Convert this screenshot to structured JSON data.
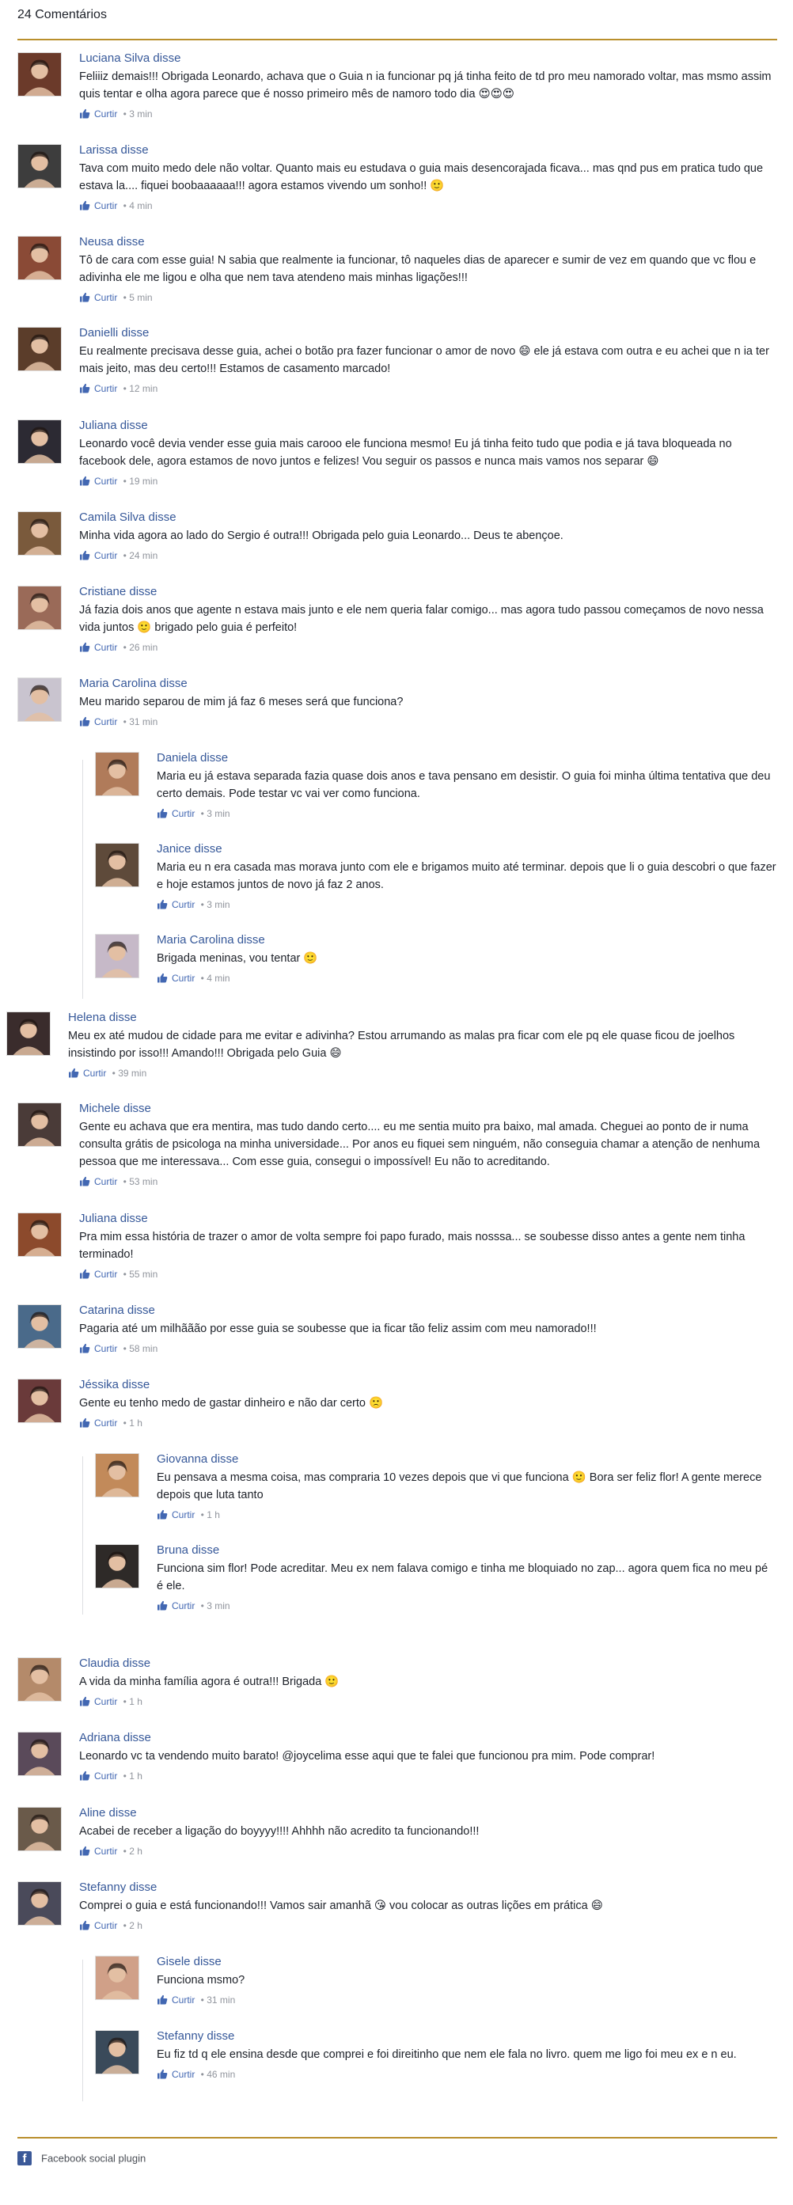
{
  "header": {
    "count_label": "24 Comentários"
  },
  "like_label": "Curtir",
  "comments": [
    {
      "name": "Luciana Silva disse",
      "text": "Feliiiz demais!!! Obrigada Leonardo, achava que o Guia n ia funcionar pq já tinha feito de td pro meu namorado voltar, mas msmo assim quis tentar e olha agora parece que é nosso primeiro mês de namoro todo dia 😍😍😍",
      "time": "3 min"
    },
    {
      "name": "Larissa disse",
      "text": "Tava com muito medo dele não voltar. Quanto mais eu estudava o guia mais desencorajada ficava... mas qnd pus em pratica tudo que estava la.... fiquei boobaaaaaa!!! agora estamos vivendo um sonho!! 🙂",
      "time": "4 min"
    },
    {
      "name": "Neusa disse",
      "text": "Tô de cara com esse guia! N sabia que realmente ia funcionar, tô naqueles dias de aparecer e sumir de vez em quando que vc flou e adivinha ele me ligou e olha que nem tava atendeno mais minhas ligações!!!",
      "time": "5 min"
    },
    {
      "name": "Danielli disse",
      "text": "Eu realmente precisava desse guia, achei o botão pra fazer funcionar o amor de novo 😄 ele já estava com outra e eu achei que n ia ter mais jeito, mas deu certo!!! Estamos de casamento marcado!",
      "time": "12 min"
    },
    {
      "name": "Juliana disse",
      "text": "Leonardo você devia vender esse guia mais carooo ele funciona mesmo! Eu já tinha feito tudo que podia e já tava bloqueada no facebook dele, agora estamos de novo juntos e felizes! Vou seguir os passos e nunca mais vamos nos separar 😄",
      "time": "19 min"
    },
    {
      "name": "Camila Silva disse",
      "text": "Minha vida agora ao lado do Sergio é outra!!! Obrigada pelo guia Leonardo... Deus te abençoe.",
      "time": "24 min"
    },
    {
      "name": "Cristiane disse",
      "text": "Já fazia dois anos que agente n estava mais junto e ele nem queria falar comigo... mas agora tudo passou começamos de novo nessa vida juntos 🙂 brigado pelo guia é perfeito!",
      "time": "26 min"
    },
    {
      "name": "Maria Carolina disse",
      "text": "Meu marido separou de mim já faz 6 meses será que funciona?",
      "time": "31 min"
    },
    {
      "name": "Daniela disse",
      "text": "Maria eu já estava separada fazia quase dois anos e tava pensano em desistir. O guia foi minha última tentativa que deu certo demais. Pode testar vc vai ver como funciona.",
      "time": "3 min"
    },
    {
      "name": "Janice disse",
      "text": "Maria eu n era casada mas morava junto com ele e brigamos muito até terminar. depois que li o guia descobri o que fazer e hoje estamos juntos de novo já faz 2 anos.",
      "time": "3 min"
    },
    {
      "name": "Maria Carolina disse",
      "text": "Brigada meninas, vou tentar 🙂",
      "time": "4 min"
    },
    {
      "name": "Helena disse",
      "text": "Meu ex até mudou de cidade para me evitar e adivinha? Estou arrumando as malas pra ficar com ele pq ele quase ficou de joelhos insistindo por isso!!! Amando!!! Obrigada pelo Guia 😄",
      "time": "39 min"
    },
    {
      "name": "Michele disse",
      "text": "Gente eu achava que era mentira, mas tudo dando certo.... eu me sentia muito pra baixo, mal amada. Cheguei ao ponto de ir numa consulta grátis de psicologa na minha universidade... Por anos eu fiquei sem ninguém, não conseguia chamar a atenção de nenhuma pessoa que me interessava... Com esse guia, consegui o impossível! Eu não to acreditando.",
      "time": "53 min"
    },
    {
      "name": "Juliana disse",
      "text": "Pra mim essa história de trazer o amor de volta sempre foi papo furado, mais nosssa... se soubesse disso antes a gente nem tinha terminado!",
      "time": "55 min"
    },
    {
      "name": "Catarina disse",
      "text": "Pagaria até um milhããão por esse guia se soubesse que ia ficar tão feliz assim com meu namorado!!!",
      "time": "58 min"
    },
    {
      "name": "Jéssika disse",
      "text": "Gente eu tenho medo de gastar dinheiro e não dar certo 🙁",
      "time": "1 h"
    },
    {
      "name": "Giovanna disse",
      "text": "Eu pensava a mesma coisa, mas compraria 10 vezes depois que vi que funciona 🙂 Bora ser feliz flor! A gente merece depois que luta tanto",
      "time": "1 h"
    },
    {
      "name": "Bruna disse",
      "text": "Funciona sim flor! Pode acreditar. Meu ex nem falava comigo e tinha me bloquiado no zap... agora quem fica no meu pé é ele.",
      "time": "3 min"
    },
    {
      "name": "Claudia disse",
      "text": "A vida da minha família agora é outra!!! Brigada 🙂",
      "time": "1 h"
    },
    {
      "name": "Adriana disse",
      "text": "Leonardo vc ta vendendo muito barato! @joycelima esse aqui que te falei que funcionou pra mim. Pode comprar!",
      "time": "1 h"
    },
    {
      "name": "Aline disse",
      "text": "Acabei de receber a ligação do boyyyy!!!! Ahhhh não acredito ta funcionando!!!",
      "time": "2 h"
    },
    {
      "name": "Stefanny disse",
      "text": "Comprei o guia e está funcionando!!! Vamos sair amanhã 😘 vou colocar as outras lições em prática 😄",
      "time": "2 h"
    },
    {
      "name": "Gisele disse",
      "text": "Funciona msmo?",
      "time": "31 min"
    },
    {
      "name": "Stefanny disse",
      "text": "Eu fiz td q ele ensina desde que comprei e foi direitinho que nem ele fala no livro. quem me ligo foi meu ex e n eu.",
      "time": "46 min"
    }
  ],
  "footer": {
    "label": "Facebook social plugin"
  },
  "colors": {
    "accent_rule": "#b98f2c",
    "name_link": "#365899",
    "like_blue": "#4267b2",
    "meta_gray": "#90949c"
  }
}
